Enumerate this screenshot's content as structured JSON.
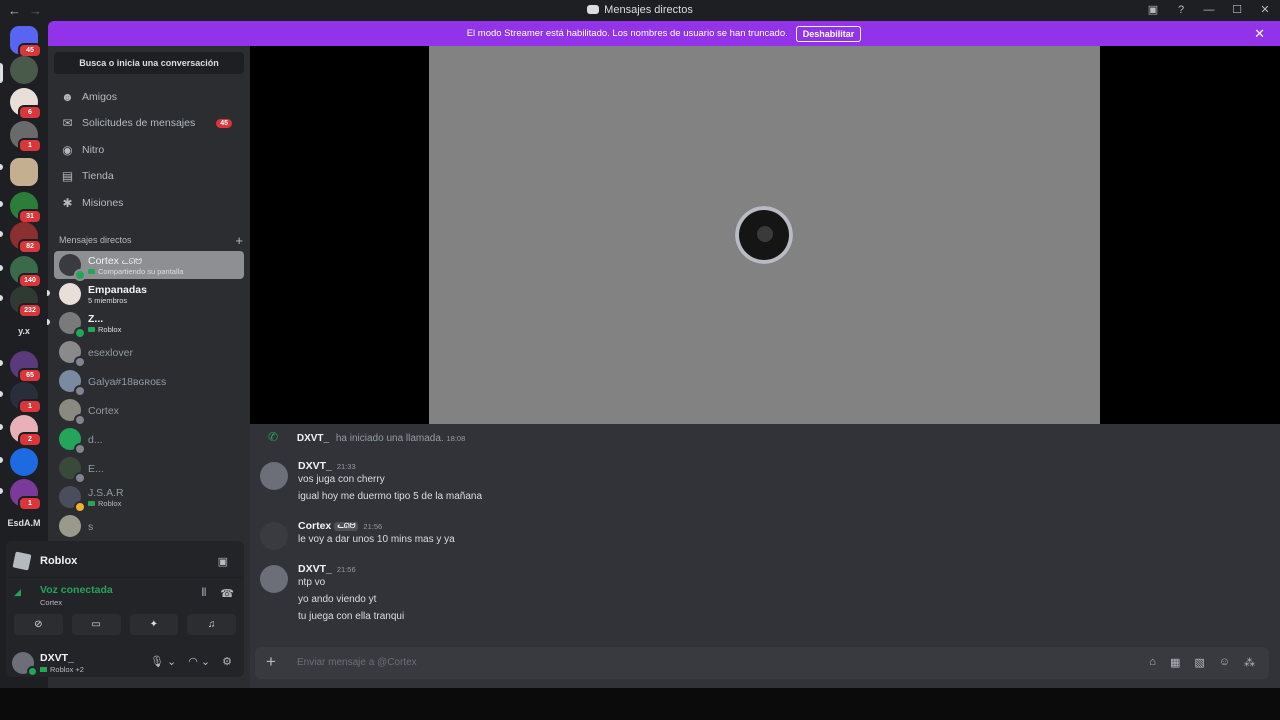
{
  "window": {
    "title": "Mensajes directos"
  },
  "banner": {
    "text": "El modo Streamer está habilitado. Los nombres de usuario se han truncado.",
    "button": "Deshabilitar"
  },
  "rail": {
    "badges": [
      "45",
      "6",
      "1",
      "31",
      "82",
      "140",
      "232",
      "65",
      "1",
      "2",
      "1"
    ],
    "text_items": [
      "y.x",
      "EsdA.M"
    ]
  },
  "sidebar": {
    "search_placeholder": "Busca o inicia una conversación",
    "nav": [
      {
        "label": "Amigos",
        "icon": "friends-icon"
      },
      {
        "label": "Solicitudes de mensajes",
        "icon": "mail-icon",
        "count": "45"
      },
      {
        "label": "Nitro",
        "icon": "nitro-icon"
      },
      {
        "label": "Tienda",
        "icon": "shop-icon"
      },
      {
        "label": "Misiones",
        "icon": "quests-icon"
      }
    ],
    "dm_header": "Mensajes directos",
    "dms": [
      {
        "name": "Cortex",
        "tag": "ᓚᘏᗢ",
        "sub": "Compartiendo su pantalla",
        "active": true
      },
      {
        "name": "Empanadas",
        "sub": "5 miembros"
      },
      {
        "name": "Z...",
        "sub": "Roblox"
      },
      {
        "name": "esexlover"
      },
      {
        "name": "Galya#18ʙɢʀᴏᴇs"
      },
      {
        "name": "Cortex"
      },
      {
        "name": "d..."
      },
      {
        "name": "E..."
      },
      {
        "name": "J.S.A.R",
        "sub": "Roblox"
      },
      {
        "name": "s"
      }
    ]
  },
  "activity": {
    "game": "Roblox",
    "voice_status": "Voz conectada",
    "voice_channel": "Cortex"
  },
  "user": {
    "name": "DXVT_",
    "status": "Roblox +2"
  },
  "chat": {
    "call_event": {
      "author": "DXVT_",
      "text": "ha iniciado una llamada.",
      "time": "18:08"
    },
    "messages": [
      {
        "author": "DXVT_",
        "time": "21:33",
        "lines": [
          "vos juga con cherry",
          "igual hoy me duermo tipo 5 de la mañana"
        ]
      },
      {
        "author": "Cortex",
        "tag": "ᓚᘏᗢ",
        "time": "21:56",
        "lines": [
          "le voy a dar unos 10 mins mas y ya"
        ]
      },
      {
        "author": "DXVT_",
        "time": "21:56",
        "lines": [
          "ntp vo",
          "yo ando viendo yt",
          "tu juega con ella tranqui"
        ]
      }
    ],
    "composer_placeholder": "Enviar mensaje a @Cortex"
  },
  "colors": {
    "accent": "#9233ea",
    "online": "#23a55a",
    "badge": "#da373c"
  }
}
